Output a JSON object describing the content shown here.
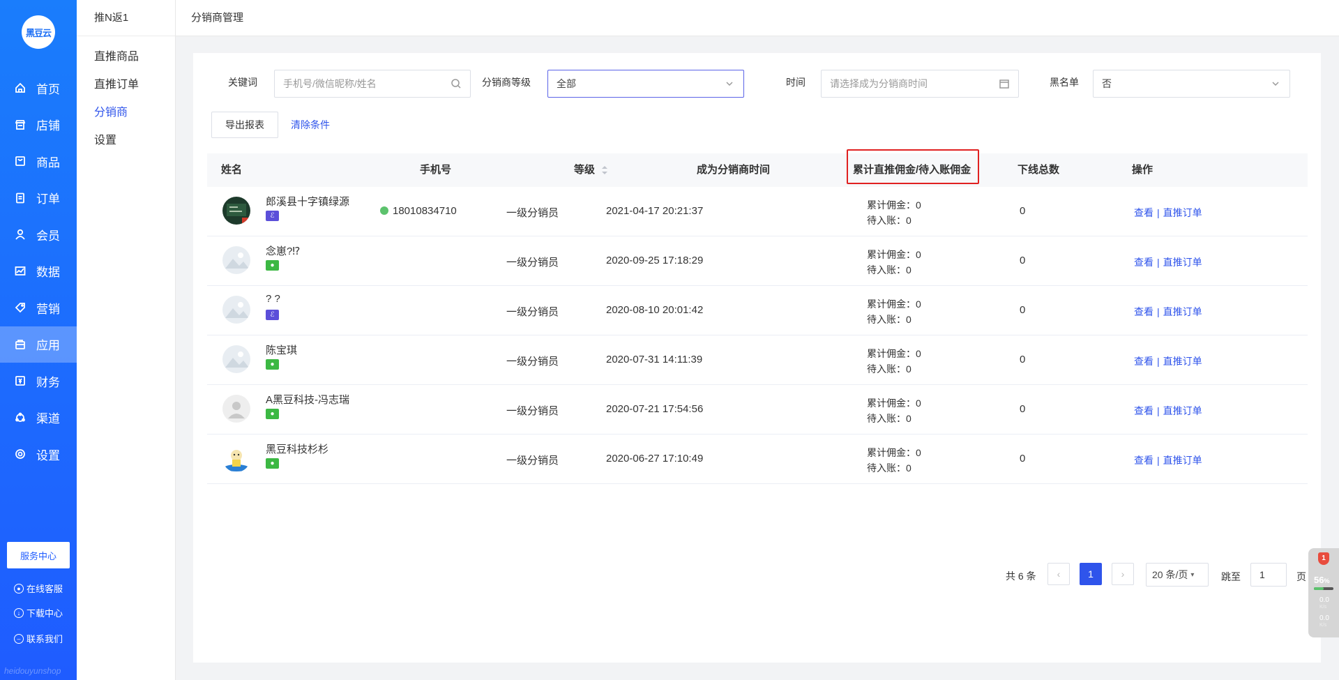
{
  "brand": {
    "logo_text": "黑豆云",
    "watermark": "heidouyunshop"
  },
  "nav": {
    "items": [
      {
        "label": "首页",
        "icon": "home-icon"
      },
      {
        "label": "店铺",
        "icon": "shop-icon"
      },
      {
        "label": "商品",
        "icon": "goods-icon"
      },
      {
        "label": "订单",
        "icon": "order-icon"
      },
      {
        "label": "会员",
        "icon": "member-icon"
      },
      {
        "label": "数据",
        "icon": "chart-icon"
      },
      {
        "label": "营销",
        "icon": "tag-icon"
      },
      {
        "label": "应用",
        "icon": "app-icon"
      },
      {
        "label": "财务",
        "icon": "finance-icon"
      },
      {
        "label": "渠道",
        "icon": "channel-icon"
      },
      {
        "label": "设置",
        "icon": "gear-icon"
      }
    ],
    "active": "应用"
  },
  "side_bottom": {
    "service_center": "服务中心",
    "online_service": "在线客服",
    "download_center": "下载中心",
    "contact_us": "联系我们"
  },
  "subnav": {
    "title": "推N返1",
    "items": [
      "直推商品",
      "直推订单",
      "分销商",
      "设置"
    ],
    "active": "分销商"
  },
  "topbar": {
    "breadcrumb": "分销商管理"
  },
  "filters": {
    "keyword_label": "关键词",
    "keyword_placeholder": "手机号/微信昵称/姓名",
    "level_label": "分销商等级",
    "level_value": "全部",
    "time_label": "时间",
    "time_placeholder": "请选择成为分销商时间",
    "blacklist_label": "黑名单",
    "blacklist_value": "否",
    "export_button": "导出报表",
    "clear_button": "清除条件"
  },
  "table": {
    "columns": {
      "name": "姓名",
      "phone": "手机号",
      "level": "等级",
      "joined": "成为分销商时间",
      "commission": "累计直推佣金/待入账佣金",
      "downline": "下线总数",
      "actions": "操作"
    },
    "commission_total_prefix": "累计佣金：",
    "commission_pending_prefix": "待入账：",
    "action_view": "查看",
    "action_sep": "|",
    "action_orders": "直推订单",
    "rows": [
      {
        "name": "郎溪县十字镇绿源",
        "badge": "mp",
        "badge_icon": "miniprogram-icon",
        "avatar": "photo",
        "phone": "18010834710",
        "level": "一级分销员",
        "joined": "2021-04-17 20:21:37",
        "total": "0",
        "pending": "0",
        "downline": "0"
      },
      {
        "name": "念崽?⁉",
        "badge": "wx",
        "badge_icon": "wechat-icon",
        "avatar": "placeholder",
        "phone": "",
        "level": "一级分销员",
        "joined": "2020-09-25 17:18:29",
        "total": "0",
        "pending": "0",
        "downline": "0"
      },
      {
        "name": "? ?",
        "badge": "mp",
        "badge_icon": "miniprogram-icon",
        "avatar": "placeholder",
        "phone": "",
        "level": "一级分销员",
        "joined": "2020-08-10 20:01:42",
        "total": "0",
        "pending": "0",
        "downline": "0"
      },
      {
        "name": "陈宝琪",
        "badge": "wx",
        "badge_icon": "wechat-icon",
        "avatar": "placeholder",
        "phone": "",
        "level": "一级分销员",
        "joined": "2020-07-31 14:11:39",
        "total": "0",
        "pending": "0",
        "downline": "0"
      },
      {
        "name": "A黑豆科技-冯志瑞",
        "badge": "wx",
        "badge_icon": "wechat-icon",
        "avatar": "default",
        "phone": "",
        "level": "一级分销员",
        "joined": "2020-07-21 17:54:56",
        "total": "0",
        "pending": "0",
        "downline": "0"
      },
      {
        "name": "黑豆科技杉杉",
        "badge": "wx",
        "badge_icon": "wechat-icon",
        "avatar": "cartoon",
        "phone": "",
        "level": "一级分销员",
        "joined": "2020-06-27 17:10:49",
        "total": "0",
        "pending": "0",
        "downline": "0"
      }
    ]
  },
  "pagination": {
    "total_text": "共 6 条",
    "current_page": "1",
    "page_size": "20 条/页",
    "jump_label": "跳至",
    "jump_value": "1",
    "page_suffix": "页",
    "prev_icon": "chevron-left-icon",
    "next_icon": "chevron-right-icon"
  },
  "float_widget": {
    "alert": "1",
    "percent": "56",
    "percent_unit": "%",
    "up_speed": "0.0",
    "down_speed": "0.0",
    "speed_unit": "K/s"
  },
  "colors": {
    "sidebar": "#1f5cff",
    "accent": "#2f54eb",
    "highlight_box": "#e02020",
    "wechat": "#3cb843",
    "miniprogram": "#5b4fd9"
  }
}
